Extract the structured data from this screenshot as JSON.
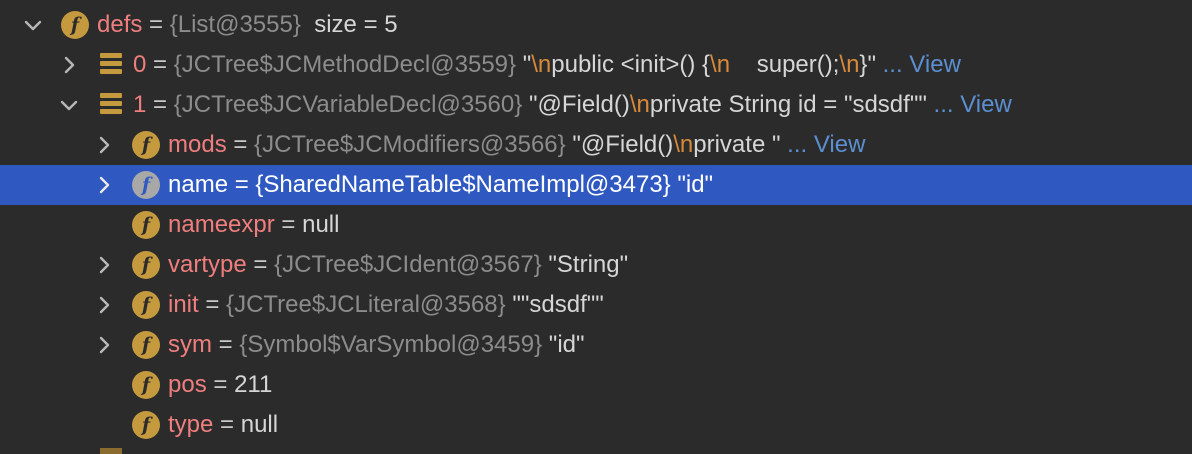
{
  "variables": [
    {
      "name": "defs",
      "eq": " = ",
      "ref": "{List@3555}",
      "sep": "  ",
      "value": "size = 5"
    },
    {
      "name": "0",
      "eq": " = ",
      "ref": "{JCTree$JCMethodDecl@3559}",
      "value_parts": [
        "\"",
        "\\n",
        "public <init>() {",
        "\\n",
        "    super();",
        "\\n",
        "}\""
      ],
      "more": " ... View"
    },
    {
      "name": "1",
      "eq": " = ",
      "ref": "{JCTree$JCVariableDecl@3560}",
      "value_parts": [
        "\"@Field()",
        "\\n",
        "private String id = \"sdsdf\"\""
      ],
      "more": " ... View"
    },
    {
      "name": "mods",
      "eq": " = ",
      "ref": "{JCTree$JCModifiers@3566}",
      "value_parts": [
        "\"@Field()",
        "\\n",
        "private \""
      ],
      "more": " ... View"
    },
    {
      "name": "name",
      "eq": " = ",
      "ref": "{SharedNameTable$NameImpl@3473}",
      "value": "\"id\""
    },
    {
      "name": "nameexpr",
      "eq": " = ",
      "value": "null"
    },
    {
      "name": "vartype",
      "eq": " = ",
      "ref": "{JCTree$JCIdent@3567}",
      "value": "\"String\""
    },
    {
      "name": "init",
      "eq": " = ",
      "ref": "{JCTree$JCLiteral@3568}",
      "value": "\"\"sdsdf\"\""
    },
    {
      "name": "sym",
      "eq": " = ",
      "ref": "{Symbol$VarSymbol@3459}",
      "value": "\"id\""
    },
    {
      "name": "pos",
      "eq": " = ",
      "value": "211"
    },
    {
      "name": "type",
      "eq": " = ",
      "value": "null"
    }
  ],
  "icons": {
    "field": "f",
    "field_icon_name": "field-icon",
    "array_icon_name": "array-element-icon"
  },
  "colors": {
    "background": "#2b2b2b",
    "selection": "#2f59c1",
    "field_name": "#ef7e7e",
    "escape": "#d88a3a",
    "link": "#5b8fd0",
    "field_icon": "#c59a3f"
  }
}
